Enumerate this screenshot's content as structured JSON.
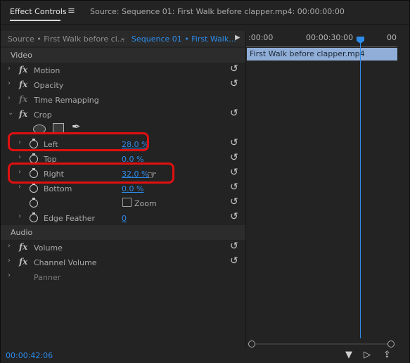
{
  "panel": {
    "tab_label": "Effect Controls",
    "menu_icon": "hamburger-menu-icon",
    "title": "Source: Sequence 01: First Walk before clapper.mp4: 00:00:00:00"
  },
  "tabs": {
    "source": "Source • First Walk before cl...",
    "sequence": "Sequence 01 • First Walk..."
  },
  "sections": {
    "video": "Video",
    "audio": "Audio"
  },
  "effects": {
    "motion": "Motion",
    "opacity": "Opacity",
    "time_remapping": "Time Remapping",
    "crop": "Crop",
    "volume": "Volume",
    "channel_volume": "Channel Volume",
    "panner": "Panner"
  },
  "fx_label": "fx",
  "crop_props": {
    "left": {
      "name": "Left",
      "value": "28.0 %"
    },
    "top": {
      "name": "Top",
      "value": "0.0 %"
    },
    "right": {
      "name": "Right",
      "value": "32.0 %"
    },
    "bottom": {
      "name": "Bottom",
      "value": "0.0 %"
    },
    "zoom": {
      "name": "Zoom",
      "checked": false
    },
    "edge_feather": {
      "name": "Edge Feather",
      "value": "0"
    }
  },
  "timeline": {
    "time_start": ":00:00",
    "time_mid": "00:00:30:00",
    "time_end": "00",
    "clip_name": "First Walk before clapper.mp4"
  },
  "footer": {
    "timecode": "00:00:42:06"
  },
  "colors": {
    "accent": "#2d8ceb",
    "highlight": "#e01010",
    "clip": "#90aed7"
  }
}
